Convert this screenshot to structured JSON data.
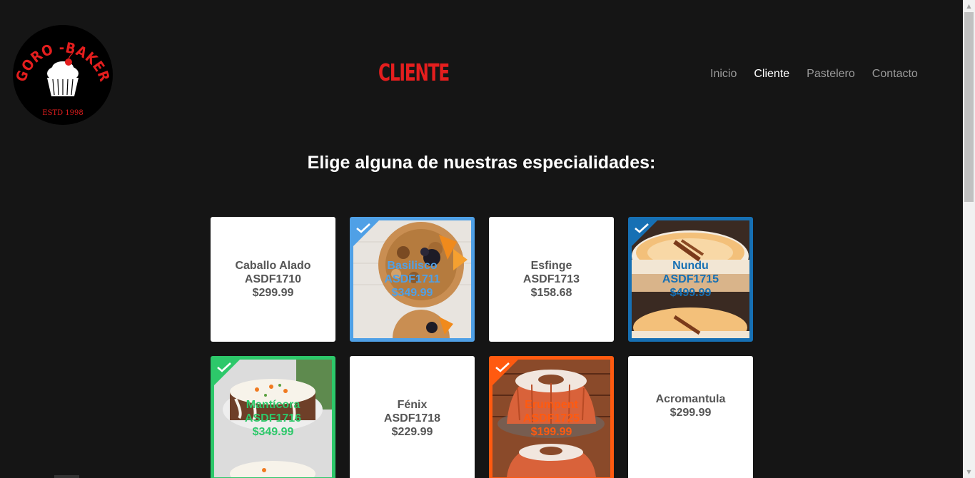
{
  "logo": {
    "brand_top": "GORO -BAKER",
    "established": "ESTD 1998"
  },
  "header": {
    "page_title": "CLIENTE",
    "nav": [
      {
        "label": "Inicio",
        "active": false
      },
      {
        "label": "Cliente",
        "active": true
      },
      {
        "label": "Pastelero",
        "active": false
      },
      {
        "label": "Contacto",
        "active": false
      }
    ]
  },
  "section": {
    "heading": "Elige alguna de nuestras especialidades:"
  },
  "products": [
    {
      "name": "Caballo Alado",
      "code": "ASDF1710",
      "price": "$299.99",
      "selected": false,
      "accent": "",
      "photo": ""
    },
    {
      "name": "Basilisco",
      "code": "ASDF1711",
      "price": "$349.99",
      "selected": true,
      "accent": "#4fa0e6",
      "photo": "nut-tart"
    },
    {
      "name": "Esfinge",
      "code": "ASDF1713",
      "price": "$158.68",
      "selected": false,
      "accent": "",
      "photo": ""
    },
    {
      "name": "Nundu",
      "code": "ASDF1715",
      "price": "$499.99",
      "selected": true,
      "accent": "#1670b4",
      "photo": "carrot-cheesecake"
    },
    {
      "name": "Mantícora",
      "code": "ASDF1716",
      "price": "$349.99",
      "selected": true,
      "accent": "#2dc86a",
      "photo": "carrot-cake"
    },
    {
      "name": "Fénix",
      "code": "ASDF1718",
      "price": "$229.99",
      "selected": false,
      "accent": "",
      "photo": ""
    },
    {
      "name": "Erumpent",
      "code": "ASDF1725",
      "price": "$199.99",
      "selected": true,
      "accent": "#ff5a10",
      "photo": "bundt-cake"
    },
    {
      "name": "Acromantula",
      "code": "",
      "price": "$299.99",
      "selected": false,
      "accent": "",
      "photo": ""
    }
  ],
  "colors": {
    "background": "#151515",
    "title_red": "#e41e1e",
    "nav_inactive": "#9a9a9a",
    "nav_active": "#ffffff",
    "card_text": "#555555"
  },
  "icons": {
    "check": "checkmark-icon",
    "scroll_up": "arrow-up-icon",
    "scroll_down": "arrow-down-icon"
  }
}
